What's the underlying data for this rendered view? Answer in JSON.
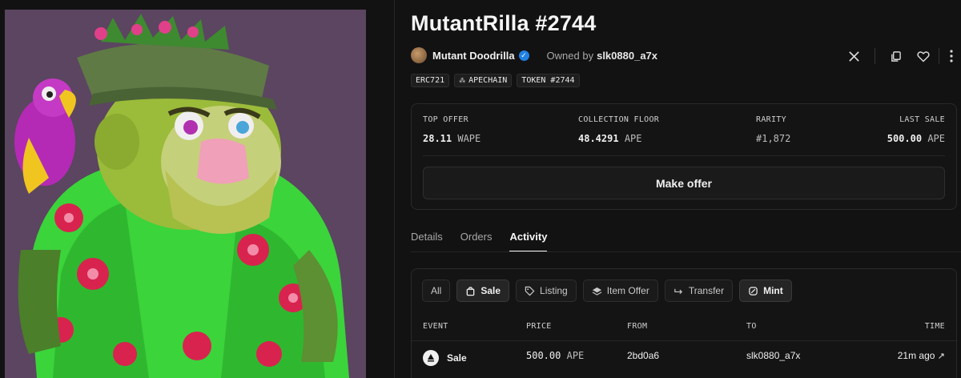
{
  "nft": {
    "title": "MutantRilla #2744",
    "collection": "Mutant Doodrilla",
    "owned_by_label": "Owned by",
    "owner": "slk0880_a7x",
    "tags": [
      "ERC721",
      "APECHAIN",
      "TOKEN #2744"
    ]
  },
  "icons": [
    "x-icon",
    "copy-icon",
    "heart-icon",
    "more-icon",
    "verified-icon",
    "apechain-icon"
  ],
  "stats": {
    "top_offer": {
      "label": "TOP OFFER",
      "value": "28.11",
      "unit": "WAPE"
    },
    "floor": {
      "label": "COLLECTION FLOOR",
      "value": "48.4291",
      "unit": "APE"
    },
    "rarity": {
      "label": "RARITY",
      "value": "#1,872"
    },
    "last_sale": {
      "label": "LAST SALE",
      "value": "500.00",
      "unit": "APE"
    }
  },
  "make_offer_label": "Make offer",
  "tabs": [
    "Details",
    "Orders",
    "Activity"
  ],
  "active_tab": "Activity",
  "filters": [
    "All",
    "Sale",
    "Listing",
    "Item Offer",
    "Transfer",
    "Mint"
  ],
  "columns": {
    "event": "EVENT",
    "price": "PRICE",
    "from": "FROM",
    "to": "TO",
    "time": "TIME"
  },
  "rows": [
    {
      "event": "Sale",
      "price": "500.00",
      "unit": "APE",
      "from": "2bd0a6",
      "to": "slk0880_a7x",
      "time": "21m ago"
    }
  ],
  "colors": {
    "background": "#121212",
    "art_bg": "#5b4560",
    "verified": "#2081e2"
  }
}
